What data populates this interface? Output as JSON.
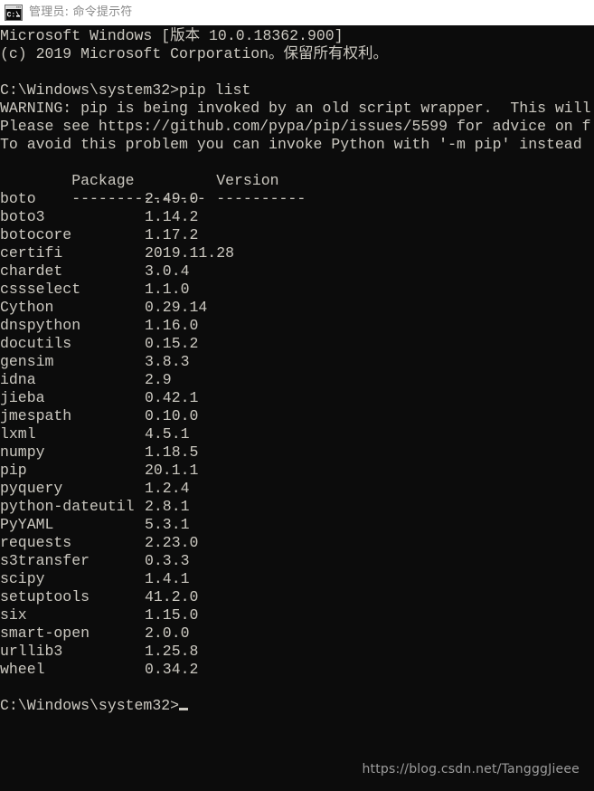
{
  "titlebar": {
    "icon": "cmd-console-icon",
    "title": "管理员: 命令提示符"
  },
  "console": {
    "header_lines": [
      "Microsoft Windows [版本 10.0.18362.900]",
      "(c) 2019 Microsoft Corporation。保留所有权利。",
      ""
    ],
    "command_line": "C:\\Windows\\system32>pip list",
    "warning_lines": [
      "WARNING: pip is being invoked by an old script wrapper.  This will",
      "Please see https://github.com/pypa/pip/issues/5599 for advice on f",
      "To avoid this problem you can invoke Python with '-m pip' instead"
    ],
    "table": {
      "headers": {
        "package": "Package",
        "version": "Version"
      },
      "separator": {
        "package": "---------------",
        "version": "----------"
      },
      "rows": [
        {
          "package": "boto",
          "version": "2.49.0"
        },
        {
          "package": "boto3",
          "version": "1.14.2"
        },
        {
          "package": "botocore",
          "version": "1.17.2"
        },
        {
          "package": "certifi",
          "version": "2019.11.28"
        },
        {
          "package": "chardet",
          "version": "3.0.4"
        },
        {
          "package": "cssselect",
          "version": "1.1.0"
        },
        {
          "package": "Cython",
          "version": "0.29.14"
        },
        {
          "package": "dnspython",
          "version": "1.16.0"
        },
        {
          "package": "docutils",
          "version": "0.15.2"
        },
        {
          "package": "gensim",
          "version": "3.8.3"
        },
        {
          "package": "idna",
          "version": "2.9"
        },
        {
          "package": "jieba",
          "version": "0.42.1"
        },
        {
          "package": "jmespath",
          "version": "0.10.0"
        },
        {
          "package": "lxml",
          "version": "4.5.1"
        },
        {
          "package": "numpy",
          "version": "1.18.5"
        },
        {
          "package": "pip",
          "version": "20.1.1"
        },
        {
          "package": "pyquery",
          "version": "1.2.4"
        },
        {
          "package": "python-dateutil",
          "version": "2.8.1"
        },
        {
          "package": "PyYAML",
          "version": "5.3.1"
        },
        {
          "package": "requests",
          "version": "2.23.0"
        },
        {
          "package": "s3transfer",
          "version": "0.3.3"
        },
        {
          "package": "scipy",
          "version": "1.4.1"
        },
        {
          "package": "setuptools",
          "version": "41.2.0"
        },
        {
          "package": "six",
          "version": "1.15.0"
        },
        {
          "package": "smart-open",
          "version": "2.0.0"
        },
        {
          "package": "urllib3",
          "version": "1.25.8"
        },
        {
          "package": "wheel",
          "version": "0.34.2"
        }
      ]
    },
    "final_prompt": "C:\\Windows\\system32>",
    "cursor": "block-cursor"
  },
  "watermark": {
    "text": "https://blog.csdn.net/TangggJieee"
  },
  "colors": {
    "titlebar_bg": "#ffffff",
    "titlebar_text": "#8a8a8a",
    "console_bg": "#0c0c0c",
    "console_text": "#ccc9c1",
    "watermark_text": "#9d9d9d"
  }
}
